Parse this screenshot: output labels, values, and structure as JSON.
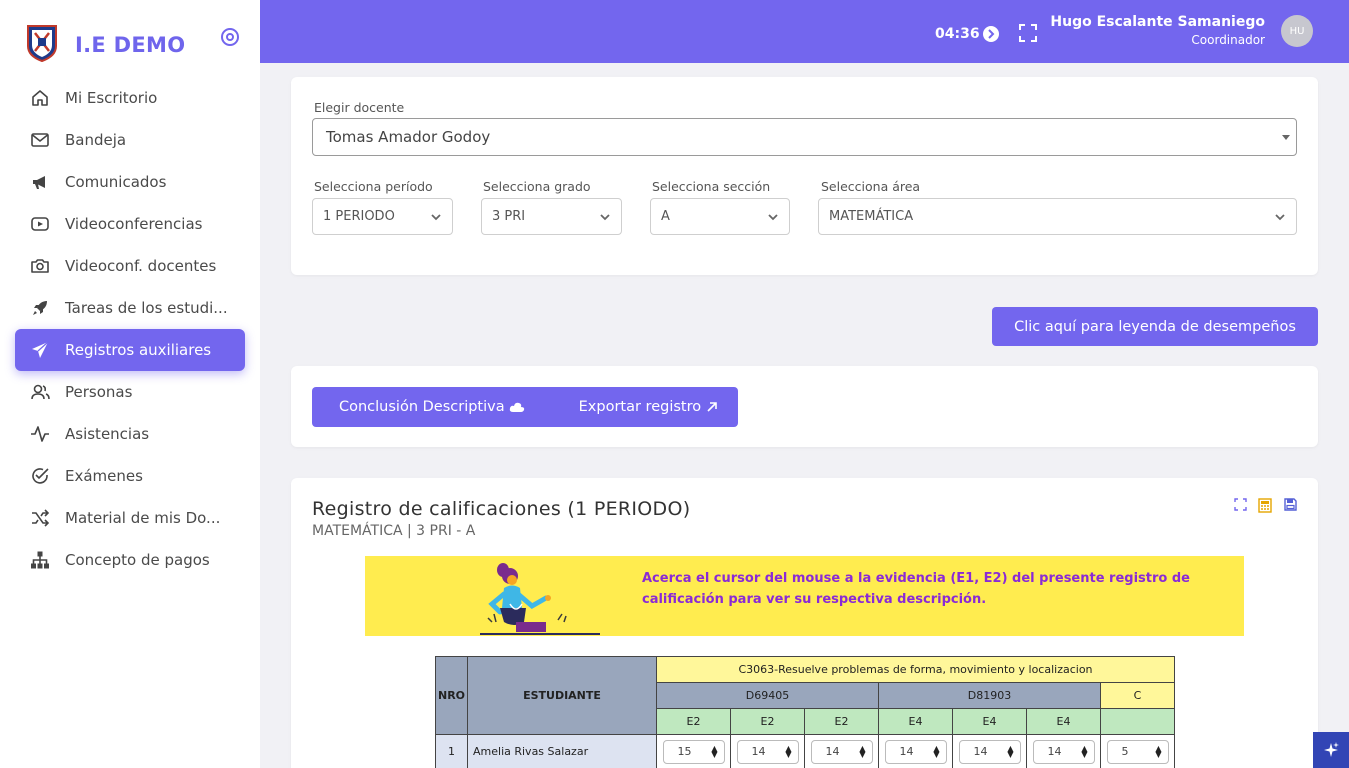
{
  "brand": {
    "name": "I.E DEMO"
  },
  "sidebar": {
    "items": [
      {
        "label": "Mi Escritorio",
        "icon": "home-icon"
      },
      {
        "label": "Bandeja",
        "icon": "mail-icon"
      },
      {
        "label": "Comunicados",
        "icon": "megaphone-icon"
      },
      {
        "label": "Videoconferencias",
        "icon": "video-icon"
      },
      {
        "label": "Videoconf. docentes",
        "icon": "camera-icon"
      },
      {
        "label": "Tareas de los estudi...",
        "icon": "rocket-icon"
      },
      {
        "label": "Registros auxiliares",
        "icon": "send-icon",
        "active": true
      },
      {
        "label": "Personas",
        "icon": "users-icon"
      },
      {
        "label": "Asistencias",
        "icon": "activity-icon"
      },
      {
        "label": "Exámenes",
        "icon": "check-circle-icon"
      },
      {
        "label": "Material de mis Do...",
        "icon": "shuffle-icon"
      },
      {
        "label": "Concepto de pagos",
        "icon": "sitemap-icon"
      }
    ]
  },
  "header": {
    "time": "04:36",
    "user_name": "Hugo Escalante Samaniego",
    "user_role": "Coordinador",
    "avatar_initials": "HU"
  },
  "filters": {
    "docente_label": "Elegir docente",
    "docente_value": "Tomas Amador Godoy",
    "periodo_label": "Selecciona período",
    "periodo_value": "1 PERIODO",
    "grado_label": "Selecciona grado",
    "grado_value": "3 PRI",
    "seccion_label": "Selecciona sección",
    "seccion_value": "A",
    "area_label": "Selecciona área",
    "area_value": "MATEMÁTICA"
  },
  "legend_button": "Clic aquí para leyenda de desempeños",
  "actions": {
    "conclusion_label": "Conclusión Descriptiva",
    "export_label": "Exportar registro"
  },
  "register": {
    "title": "Registro de calificaciones (1 PERIODO)",
    "subtitle": "MATEMÁTICA | 3 PRI - A",
    "banner_text": "Acerca el cursor del mouse a la evidencia (E1, E2) del presente registro de calificación para ver su respectiva descripción.",
    "table": {
      "nro_header": "NRO",
      "student_header": "ESTUDIANTE",
      "competency": "C3063-Resuelve problemas de forma, movimiento y localizacion",
      "groups": [
        "D69405",
        "D81903",
        "C"
      ],
      "evidences": [
        "E2",
        "E2",
        "E2",
        "E4",
        "E4",
        "E4",
        ""
      ],
      "rows": [
        {
          "nro": "1",
          "name": "Amelia Rivas Salazar",
          "grades": [
            "15",
            "14",
            "14",
            "14",
            "14",
            "14",
            "5"
          ]
        }
      ]
    }
  },
  "colors": {
    "accent": "#7366ee",
    "banner": "#ffec4f",
    "banner_text": "#8a2ad6"
  }
}
